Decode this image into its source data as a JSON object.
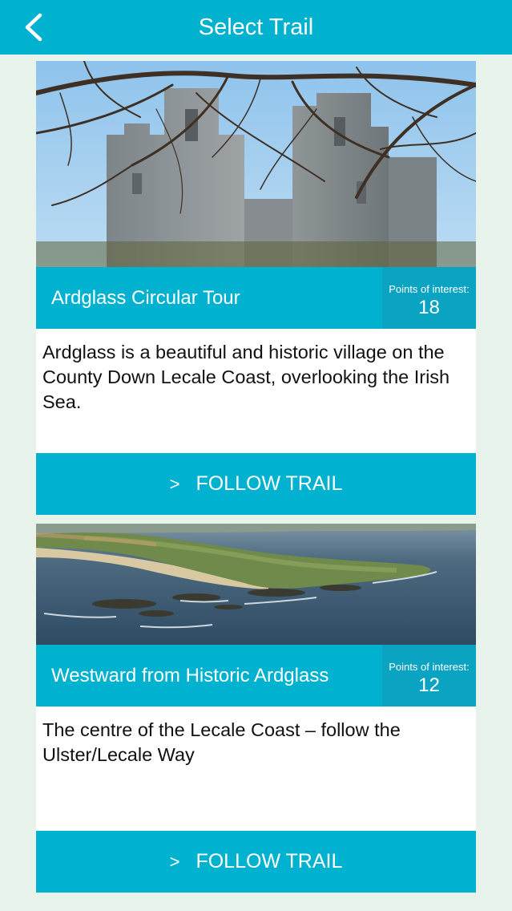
{
  "header": {
    "title": "Select Trail",
    "back_icon": "chevron-left-icon"
  },
  "colors": {
    "accent": "#00b2cf",
    "poi_box": "#0aa4c2",
    "background": "#e8f3ec"
  },
  "trails": [
    {
      "name": "Ardglass Circular Tour",
      "poi_label": "Points of interest:",
      "poi_count": "18",
      "description": "Ardglass is a beautiful and historic village on the County Down Lecale Coast, overlooking the Irish Sea.",
      "follow_arrow": ">",
      "follow_label": "FOLLOW TRAIL"
    },
    {
      "name": "Westward from Historic Ardglass",
      "poi_label": "Points of interest:",
      "poi_count": "12",
      "description": "The centre of the Lecale Coast – follow the Ulster/Lecale Way",
      "follow_arrow": ">",
      "follow_label": "FOLLOW TRAIL"
    }
  ]
}
